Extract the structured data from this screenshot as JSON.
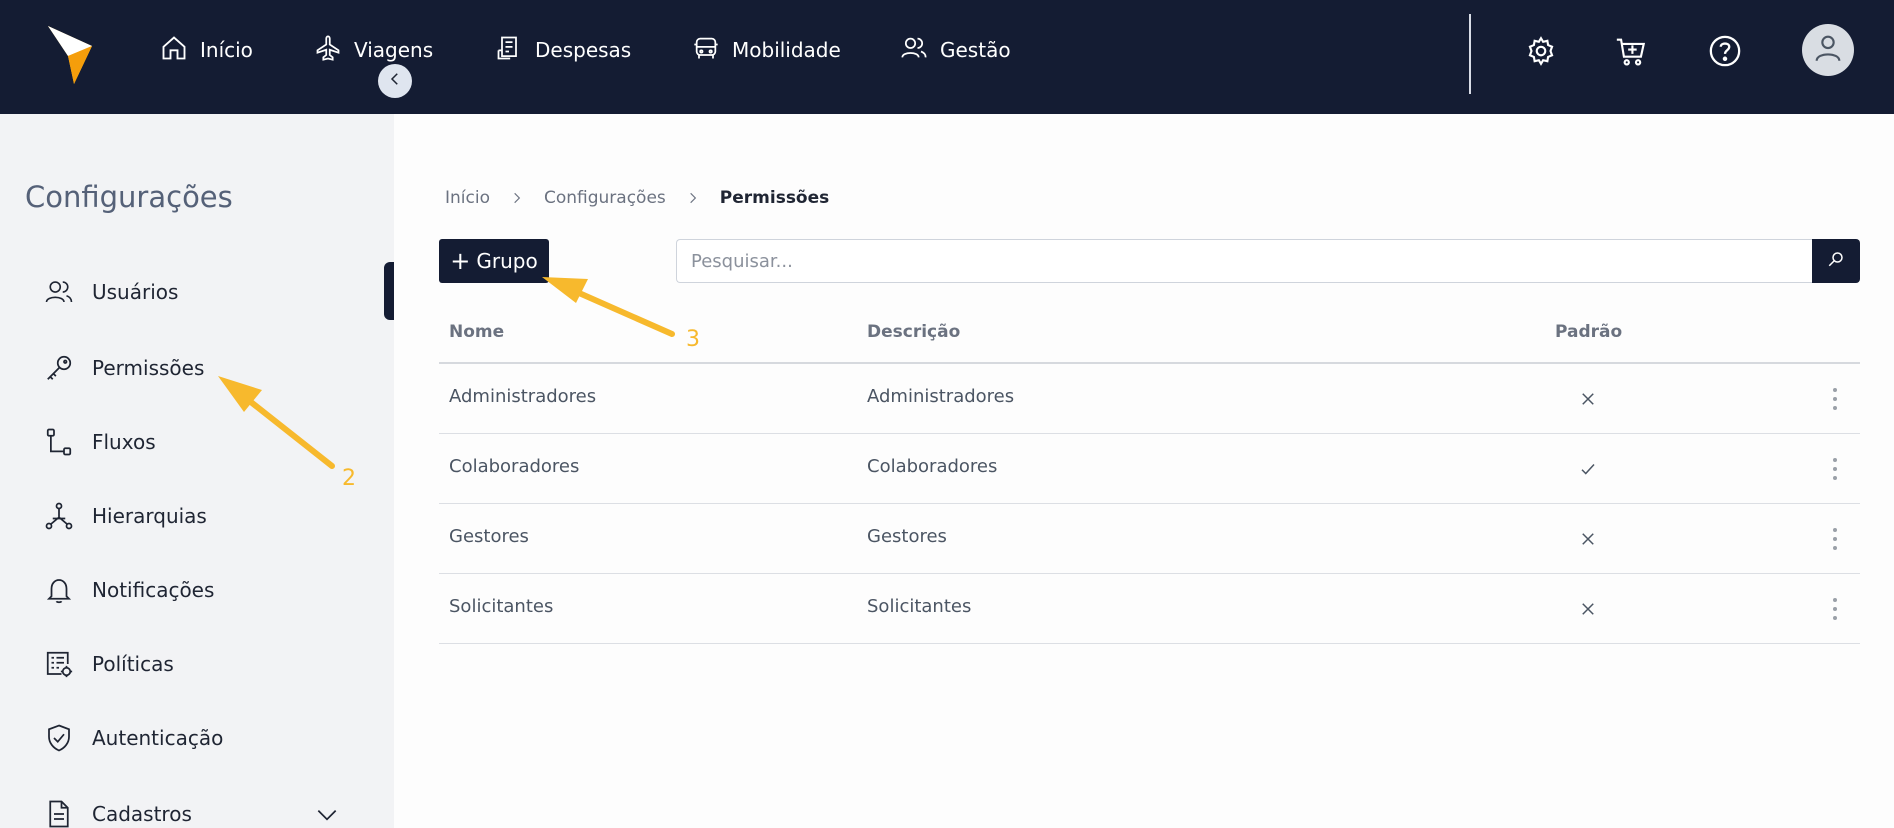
{
  "topnav": {
    "items": [
      {
        "label": "Início",
        "icon": "home-icon"
      },
      {
        "label": "Viagens",
        "icon": "plane-icon"
      },
      {
        "label": "Despesas",
        "icon": "receipt-icon"
      },
      {
        "label": "Mobilidade",
        "icon": "car-icon"
      },
      {
        "label": "Gestão",
        "icon": "users-icon"
      }
    ],
    "right_icons": [
      "gear-icon",
      "cart-plus-icon",
      "help-icon",
      "user-avatar-icon"
    ]
  },
  "sidebar": {
    "title": "Configurações",
    "items": [
      {
        "label": "Usuários",
        "icon": "users-icon"
      },
      {
        "label": "Permissões",
        "icon": "key-icon"
      },
      {
        "label": "Fluxos",
        "icon": "flow-icon"
      },
      {
        "label": "Hierarquias",
        "icon": "hierarchy-icon"
      },
      {
        "label": "Notificações",
        "icon": "bell-icon"
      },
      {
        "label": "Políticas",
        "icon": "policy-icon"
      },
      {
        "label": "Autenticação",
        "icon": "shield-check-icon"
      },
      {
        "label": "Cadastros",
        "icon": "document-icon"
      }
    ]
  },
  "breadcrumb": {
    "items": [
      "Início",
      "Configurações",
      "Permissões"
    ]
  },
  "toolbar": {
    "add_button_label": "Grupo",
    "search_placeholder": "Pesquisar...",
    "search_value": ""
  },
  "table": {
    "headers": {
      "name": "Nome",
      "description": "Descrição",
      "standard": "Padrão"
    },
    "rows": [
      {
        "name": "Administradores",
        "description": "Administradores",
        "standard": false
      },
      {
        "name": "Colaboradores",
        "description": "Colaboradores",
        "standard": true
      },
      {
        "name": "Gestores",
        "description": "Gestores",
        "standard": false
      },
      {
        "name": "Solicitantes",
        "description": "Solicitantes",
        "standard": false
      }
    ]
  },
  "annotations": {
    "step_2": "2",
    "step_3": "3"
  },
  "colors": {
    "nav_bg": "#141c33",
    "accent": "#f7b92d",
    "sidebar_bg": "#f2f3f5"
  }
}
